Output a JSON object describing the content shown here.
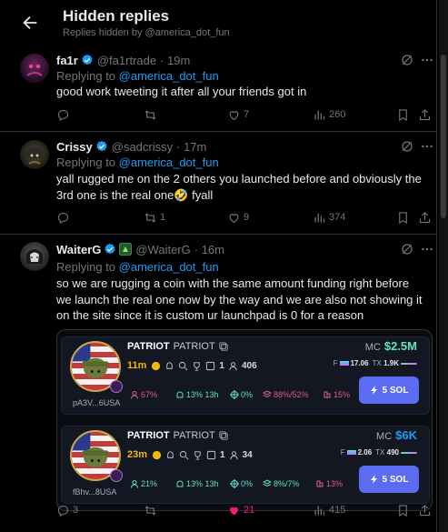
{
  "header": {
    "title": "Hidden replies",
    "subtitle": "Replies hidden by @america_dot_fun"
  },
  "colors": {
    "accent": "#1d9bf0",
    "like": "#f91880",
    "verified": "#1d9bf0",
    "mc_green": "#5fe0c8",
    "buy_button": "#5b6cf2",
    "age_yellow": "#f0b90b"
  },
  "tweets": [
    {
      "name": "fa1r",
      "handle": "@fa1rtrade",
      "time": "· 19m",
      "reply_prefix": "Replying to ",
      "reply_mention": "@america_dot_fun",
      "text": "good work tweeting it after all your friends got in",
      "actions": {
        "reply": "",
        "retweet": "",
        "like": "7",
        "views": "260"
      }
    },
    {
      "name": "Crissy",
      "handle": "@sadcrissy",
      "time": "· 17m",
      "reply_prefix": "Replying to ",
      "reply_mention": "@america_dot_fun",
      "text": "yall rugged me on the 2 others you launched before and obviously the 3rd one is the real one🤣 fyall",
      "actions": {
        "reply": "",
        "retweet": "1",
        "like": "9",
        "views": "374"
      }
    },
    {
      "name": "WaiterG",
      "handle": "@WaiterG",
      "time": "· 16m",
      "reply_prefix": "Replying to ",
      "reply_mention": "@america_dot_fun",
      "text": "so we are rugging a coin with the same amount funding right before we launch the real one now by the way and we are also not showing it on the site since it is custom ur launchpad is 0 for a reason",
      "actions": {
        "reply": "3",
        "retweet": "",
        "like": "21",
        "views": "415"
      }
    }
  ],
  "coins": [
    {
      "name": "PATRIOT",
      "symbol": "PATRIOT",
      "address": "pA3V...6USA",
      "age": "11m",
      "holders": "1",
      "count": "406",
      "mc_label": "MC",
      "mc_value": "$2.5M",
      "f_label": "F",
      "f_value": "17.06",
      "tx_label": "TX",
      "tx_value": "1.9K",
      "stats": [
        "67%",
        "13% 13h",
        "0%",
        "88%/52%",
        "15%"
      ],
      "buy_label": "5 SOL"
    },
    {
      "name": "PATRIOT",
      "symbol": "PATRIOT",
      "address": "fBhv...8USA",
      "age": "23m",
      "holders": "1",
      "count": "34",
      "mc_label": "MC",
      "mc_value": "$6K",
      "f_label": "F",
      "f_value": "2.06",
      "tx_label": "TX",
      "tx_value": "490",
      "stats": [
        "21%",
        "13% 13h",
        "0%",
        "8%/7%",
        "13%"
      ],
      "buy_label": "5 SOL"
    }
  ]
}
